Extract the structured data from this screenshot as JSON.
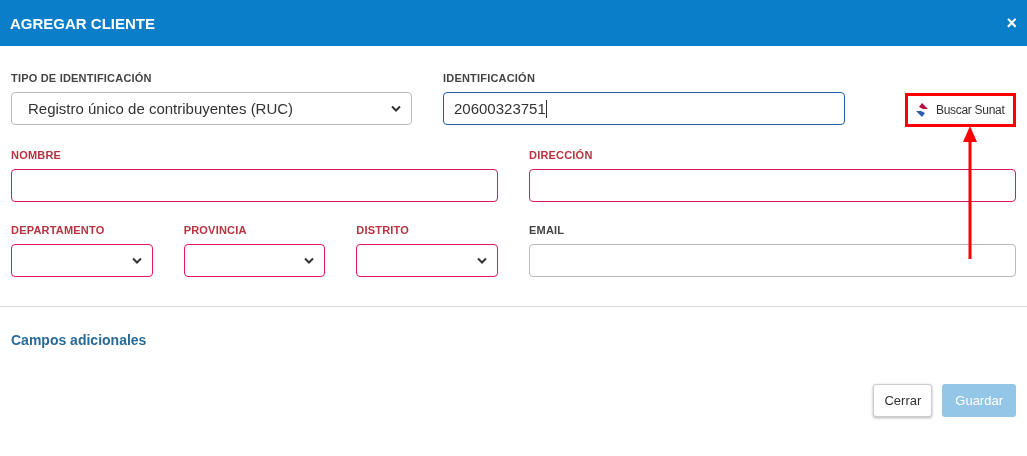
{
  "dialog": {
    "title": "AGREGAR CLIENTE",
    "close": "×"
  },
  "row1": [
    {
      "kind": "select",
      "label": "TIPO DE IDENTIFICACIÓN",
      "value": "Registro único de contribuyentes (RUC)",
      "required": false,
      "focused": false
    },
    {
      "kind": "input",
      "label": "IDENTIFICACIÓN",
      "value": "20600323751",
      "required": false,
      "focused": true
    }
  ],
  "sunat_button": {
    "label": "Buscar Sunat",
    "highlighted": true
  },
  "row2": [
    {
      "kind": "input",
      "label": "NOMBRE",
      "required": true,
      "focused": false
    },
    {
      "kind": "input",
      "label": "DIRECCIÓN",
      "required": true,
      "focused": false
    }
  ],
  "location": [
    {
      "kind": "select",
      "label": "DEPARTAMENTO",
      "required": true,
      "focused": false
    },
    {
      "kind": "select",
      "label": "PROVINCIA",
      "required": true,
      "focused": false
    },
    {
      "kind": "select",
      "label": "DISTRITO",
      "required": true,
      "focused": false
    }
  ],
  "email": {
    "kind": "input",
    "label": "EMAIL",
    "required": false,
    "focused": false
  },
  "additional_link": "Campos adicionales",
  "buttons": [
    {
      "label": "Cerrar",
      "kind": "secondary",
      "disabled": false
    },
    {
      "label": "Guardar",
      "kind": "primary",
      "disabled": true
    }
  ]
}
